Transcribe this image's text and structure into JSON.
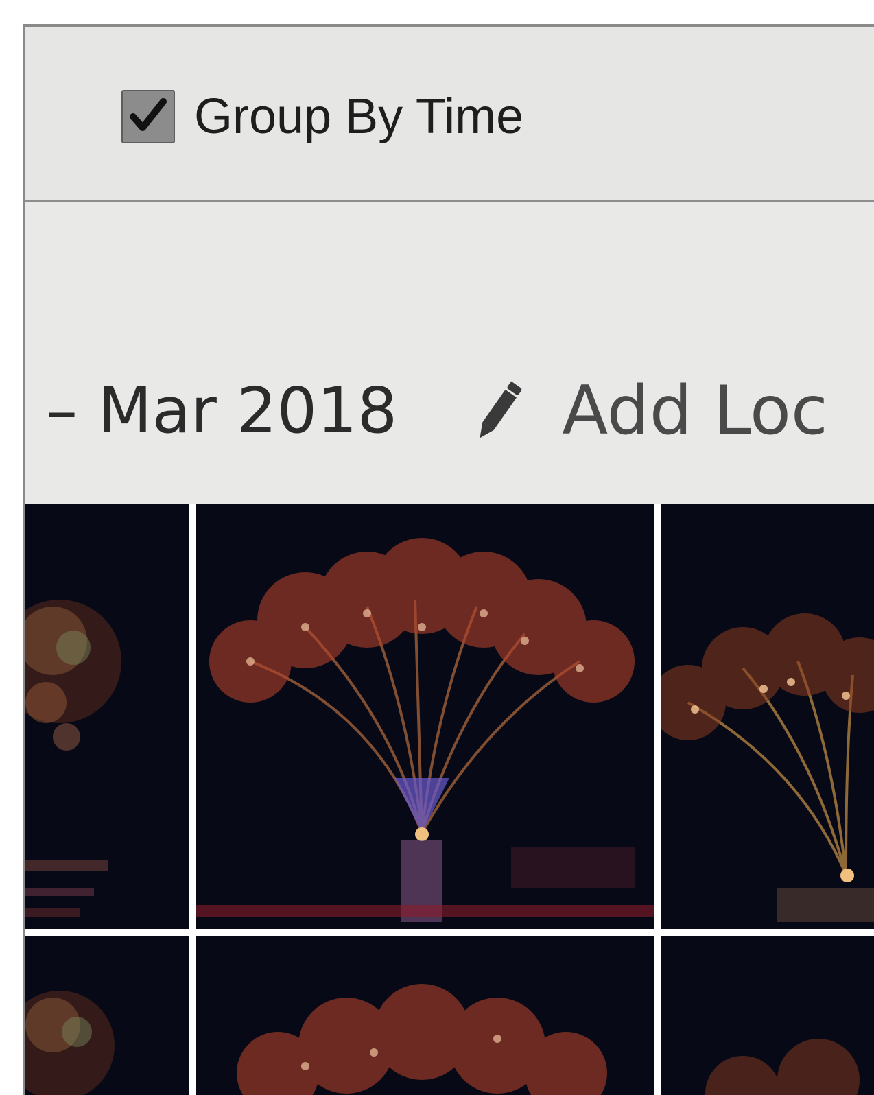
{
  "toolbar": {
    "group_by_time": {
      "label": "Group By Time",
      "checked": true
    }
  },
  "section": {
    "date_range": "– Mar 2018",
    "edit_icon": "pencil-icon",
    "add_location_label": "Add Loc"
  },
  "photos": {
    "count_visible": 6,
    "subject": "fireworks"
  },
  "colors": {
    "background": "#e9e9e7",
    "checkbox": "#8c8c8c",
    "text": "#2b2b2b",
    "photo_background": "#070a16"
  }
}
